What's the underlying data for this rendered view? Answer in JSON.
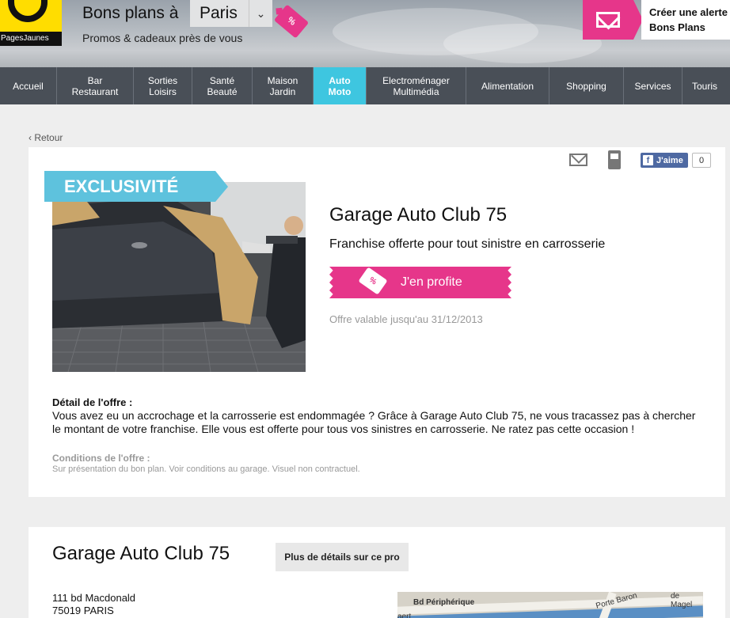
{
  "header": {
    "logo_text": "PagesJaunes",
    "title": "Bons plans à",
    "city": "Paris",
    "subtitle": "Promos & cadeaux près de vous",
    "tag_symbol": "%",
    "alert_line1": "Créer une alerte",
    "alert_line2": "Bons Plans"
  },
  "nav": [
    {
      "line1": "Accueil",
      "line2": "",
      "active": false
    },
    {
      "line1": "Bar",
      "line2": "Restaurant",
      "active": false
    },
    {
      "line1": "Sorties",
      "line2": "Loisirs",
      "active": false
    },
    {
      "line1": "Santé",
      "line2": "Beauté",
      "active": false
    },
    {
      "line1": "Maison",
      "line2": "Jardin",
      "active": false
    },
    {
      "line1": "Auto",
      "line2": "Moto",
      "active": true
    },
    {
      "line1": "Electroménager",
      "line2": "Multimédia",
      "active": false
    },
    {
      "line1": "Alimentation",
      "line2": "",
      "active": false
    },
    {
      "line1": "Shopping",
      "line2": "",
      "active": false
    },
    {
      "line1": "Services",
      "line2": "",
      "active": false
    },
    {
      "line1": "Touris",
      "line2": "",
      "active": false
    }
  ],
  "back_link": "Retour",
  "share": {
    "fb_label": "J'aime",
    "fb_count": "0"
  },
  "offer": {
    "badge": "EXCLUSIVITÉ",
    "title": "Garage Auto Club 75",
    "subtitle": "Franchise offerte pour tout sinistre en carrosserie",
    "cta_label": "J'en profite",
    "cta_tag": "%",
    "validity": "Offre valable jusqu'au 31/12/2013",
    "detail_heading": "Détail de l'offre :",
    "detail_text": "Vous avez eu un accrochage et la carrosserie est endommagée ? Grâce à Garage Auto Club 75, ne vous tracassez pas à chercher le montant de votre franchise. Elle vous est offerte pour tous vos sinistres en carrosserie. Ne ratez pas cette occasion !",
    "conditions_heading": "Conditions de l'offre :",
    "conditions_text": "Sur présentation du bon plan. Voir conditions au garage. Visuel non contractuel."
  },
  "business": {
    "name": "Garage Auto Club 75",
    "more_button": "Plus de détails sur ce pro",
    "address_line1": "111 bd Macdonald",
    "address_line2": "75019 PARIS"
  },
  "map_labels": [
    "Bd Périphérique",
    "Porte Baron",
    "de Magel",
    "aert"
  ],
  "colors": {
    "brand_pink": "#e6368a",
    "nav_bg": "#494f57",
    "nav_active": "#3ec6e0",
    "badge_blue": "#5ec2dd",
    "logo_yellow": "#ffdd00"
  }
}
